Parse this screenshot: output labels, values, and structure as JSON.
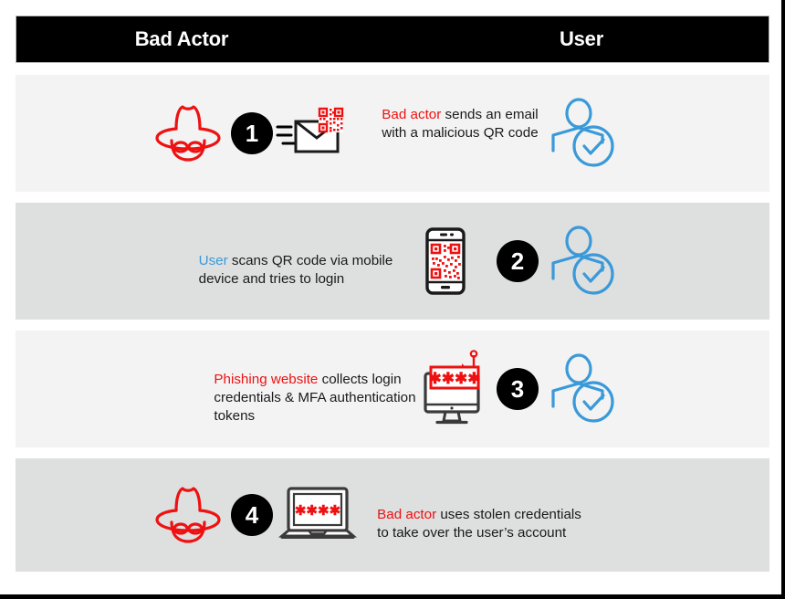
{
  "header": {
    "left_label": "Bad Actor",
    "right_label": "User",
    "background_color": "#000000",
    "text_color": "#ffffff"
  },
  "colors": {
    "red": "#ee1111",
    "blue": "#3a9ad9",
    "black": "#000000",
    "row_light": "#f3f3f3",
    "row_dark": "#dedfdf"
  },
  "steps": [
    {
      "number": "1",
      "caption_highlight": "Bad actor",
      "caption_highlight_color": "red",
      "caption_rest": " sends an email\nwith a malicious QR code",
      "icons": [
        "bad-actor-icon",
        "email-qr-icon",
        "arrow-right",
        "user-verified-icon"
      ],
      "row_background": "#f3f3f3"
    },
    {
      "number": "2",
      "caption_highlight": "User",
      "caption_highlight_color": "blue",
      "caption_rest": " scans QR code via mobile\ndevice and tries to login",
      "icons": [
        "mobile-qr-icon",
        "user-verified-icon"
      ],
      "row_background": "#dedfdf"
    },
    {
      "number": "3",
      "caption_highlight": "Phishing website",
      "caption_highlight_color": "red",
      "caption_rest": " collects login\ncredentials & MFA authentication\ntokens",
      "icons": [
        "monitor-phishing-icon",
        "user-verified-icon"
      ],
      "row_background": "#f3f3f3"
    },
    {
      "number": "4",
      "caption_highlight": "Bad actor",
      "caption_highlight_color": "red",
      "caption_rest": " uses stolen credentials\nto take over the user’s account",
      "icons": [
        "bad-actor-icon",
        "laptop-credentials-icon"
      ],
      "row_background": "#dedfdf"
    }
  ],
  "password_mask": "✱✱✱✱"
}
